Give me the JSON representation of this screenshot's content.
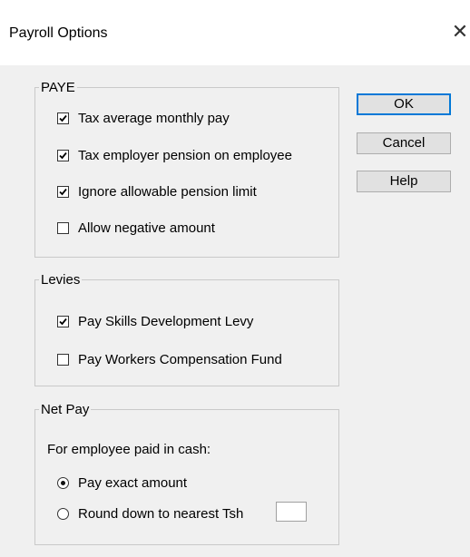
{
  "window": {
    "title": "Payroll Options",
    "close_glyph": "✕"
  },
  "paye": {
    "legend": "PAYE",
    "items": [
      {
        "label": "Tax average monthly pay",
        "checked": true
      },
      {
        "label": "Tax employer pension on employee",
        "checked": true
      },
      {
        "label": "Ignore allowable pension limit",
        "checked": true
      },
      {
        "label": "Allow negative amount",
        "checked": false
      }
    ]
  },
  "levies": {
    "legend": "Levies",
    "items": [
      {
        "label": "Pay Skills Development Levy",
        "checked": true
      },
      {
        "label": "Pay Workers Compensation Fund",
        "checked": false
      }
    ]
  },
  "netpay": {
    "legend": "Net Pay",
    "prompt": "For employee paid in cash:",
    "options": [
      {
        "label": "Pay exact amount",
        "selected": true
      },
      {
        "label": "Round down to nearest Tsh",
        "selected": false
      }
    ],
    "round_value": ""
  },
  "buttons": {
    "ok": "OK",
    "cancel": "Cancel",
    "help": "Help"
  }
}
